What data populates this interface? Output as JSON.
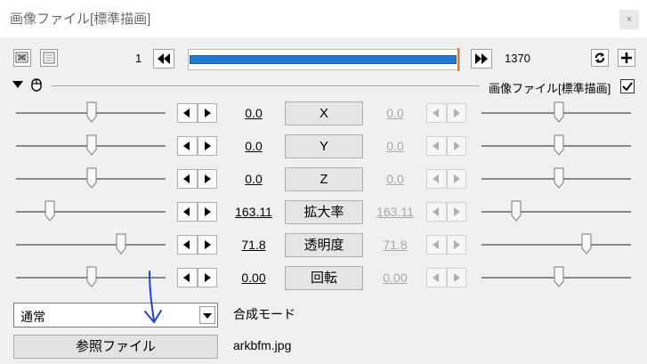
{
  "window": {
    "title": "画像ファイル[標準描画]",
    "close_glyph": "×"
  },
  "toolbar": {
    "start_frame": "1",
    "end_frame": "1370",
    "timeline_fill": 1.0,
    "icons": [
      "window-icon",
      "grid-icon",
      "rewind-icon",
      "forward-icon",
      "loop-icon",
      "add-icon"
    ]
  },
  "section": {
    "object_label": "画像ファイル[標準描画]",
    "enabled": true
  },
  "params": [
    {
      "name": "X",
      "left": "0.0",
      "right": "0.0",
      "left_disabled": false,
      "right_disabled": true
    },
    {
      "name": "Y",
      "left": "0.0",
      "right": "0.0",
      "left_disabled": false,
      "right_disabled": true
    },
    {
      "name": "Z",
      "left": "0.0",
      "right": "0.0",
      "left_disabled": false,
      "right_disabled": true
    },
    {
      "name": "拡大率",
      "left": "163.11",
      "right": "163.11",
      "left_disabled": false,
      "right_disabled": true
    },
    {
      "name": "透明度",
      "left": "71.8",
      "right": "71.8",
      "left_disabled": false,
      "right_disabled": true
    },
    {
      "name": "回転",
      "left": "0.00",
      "right": "0.00",
      "left_disabled": false,
      "right_disabled": true
    }
  ],
  "blend": {
    "value": "通常",
    "label": "合成モード"
  },
  "file": {
    "button_label": "参照ファイル",
    "filename": "arkbfm.jpg"
  },
  "colors": {
    "timeline_fill": "#1e7cd9",
    "annotation": "#1f3fe0",
    "timeline_marker": "#e0791a"
  }
}
